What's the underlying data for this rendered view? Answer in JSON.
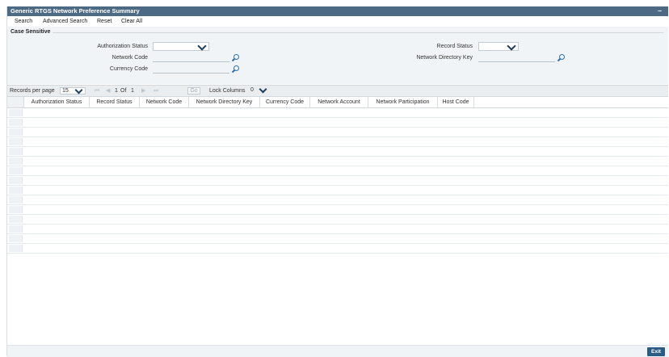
{
  "window": {
    "title": "Generic RTGS Network Preference Summary",
    "minimize": "–"
  },
  "toolbar": {
    "search": "Search",
    "advanced_search": "Advanced Search",
    "reset": "Reset",
    "clear_all": "Clear All"
  },
  "search_panel": {
    "legend": "Case Sensitive",
    "authorization_status": {
      "label": "Authorization Status",
      "value": ""
    },
    "network_code": {
      "label": "Network Code",
      "value": ""
    },
    "currency_code": {
      "label": "Currency Code",
      "value": ""
    },
    "record_status": {
      "label": "Record Status",
      "value": ""
    },
    "network_directory_key": {
      "label": "Network Directory Key",
      "value": ""
    }
  },
  "pager": {
    "records_per_page_label": "Records per page",
    "records_per_page_value": "15",
    "first": "⏮",
    "prev": "◀",
    "page": "1",
    "of_label": "Of",
    "total_pages": "1",
    "next": "▶",
    "last": "⏭",
    "go_label": "Go",
    "lock_columns_label": "Lock Columns",
    "lock_columns_value": "0"
  },
  "grid": {
    "columns": [
      "Authorization Status",
      "Record Status",
      "Network Code",
      "Network Directory Key",
      "Currency Code",
      "Network Account",
      "Network Participation",
      "Host Code"
    ],
    "row_count": 15
  },
  "footer": {
    "exit_label": "Exit"
  },
  "colors": {
    "title_bar": "#4d6a85",
    "exit_button": "#2b5b84",
    "lookup_icon": "#2b6fb0"
  }
}
